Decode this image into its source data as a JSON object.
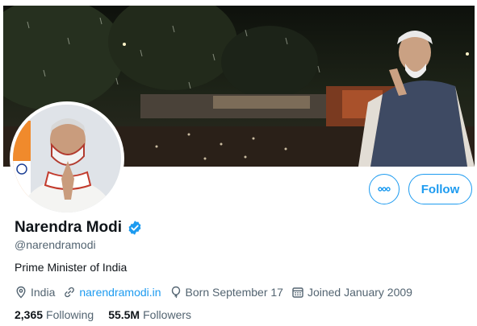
{
  "profile": {
    "display_name": "Narendra Modi",
    "handle": "@narendramodi",
    "bio": "Prime Minister of India",
    "verified_icon": "verified-badge-icon",
    "location": "India",
    "website": "narendramodi.in",
    "birthday": "Born September 17",
    "joined": "Joined January 2009",
    "following_count": "2,365",
    "following_label": "Following",
    "followers_count": "55.5M",
    "followers_label": "Followers"
  },
  "actions": {
    "follow_label": "Follow",
    "more_icon": "more-options-icon"
  },
  "icons": {
    "location": "location-pin-icon",
    "website": "link-icon",
    "birthday": "balloon-icon",
    "joined": "calendar-icon"
  },
  "colors": {
    "accent": "#1d9bf0",
    "text_primary": "#0f1419",
    "text_secondary": "#536471",
    "background": "#ffffff"
  }
}
